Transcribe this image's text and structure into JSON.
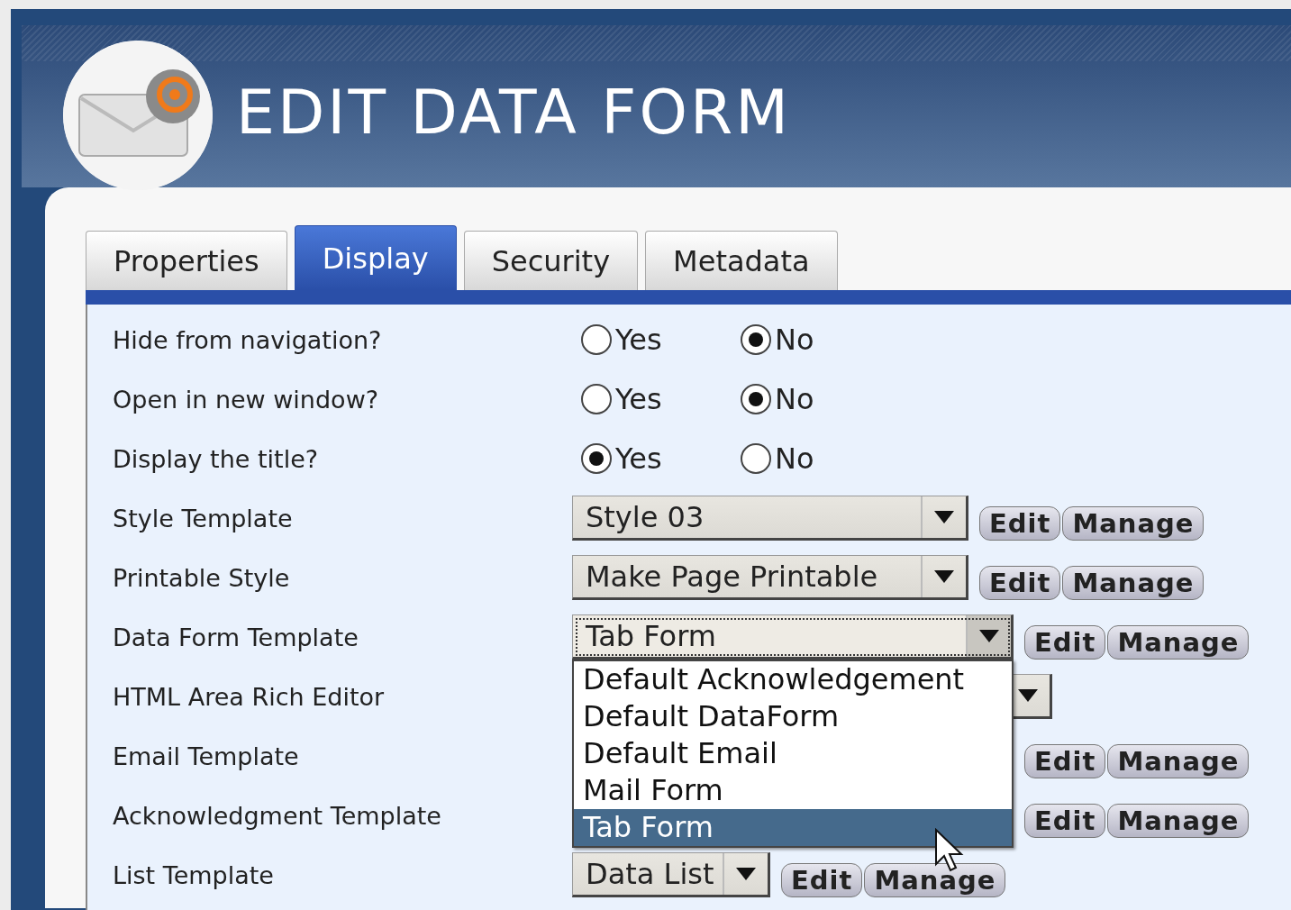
{
  "window": {
    "title": "EDIT DATA FORM"
  },
  "tabs": [
    {
      "label": "Properties",
      "selected": false
    },
    {
      "label": "Display",
      "selected": true
    },
    {
      "label": "Security",
      "selected": false
    },
    {
      "label": "Metadata",
      "selected": false
    }
  ],
  "rows": [
    {
      "kind": "radio",
      "label": "Hide from navigation?",
      "options": [
        {
          "label": "Yes",
          "selected": false
        },
        {
          "label": "No",
          "selected": true
        }
      ]
    },
    {
      "kind": "radio",
      "label": "Open in new window?",
      "options": [
        {
          "label": "Yes",
          "selected": false
        },
        {
          "label": "No",
          "selected": true
        }
      ]
    },
    {
      "kind": "radio",
      "label": "Display the title?",
      "options": [
        {
          "label": "Yes",
          "selected": true
        },
        {
          "label": "No",
          "selected": false
        }
      ]
    },
    {
      "kind": "select",
      "label": "Style Template",
      "value": "Style 03",
      "buttons": [
        "Edit",
        "Manage"
      ]
    },
    {
      "kind": "select",
      "label": "Printable Style",
      "value": "Make Page Printable",
      "buttons": [
        "Edit",
        "Manage"
      ]
    },
    {
      "kind": "select",
      "label": "Data Form Template",
      "value": "Tab Form",
      "focused": true,
      "expanded": true,
      "buttons": [
        "Edit",
        "Manage"
      ],
      "options": [
        {
          "label": "Default Acknowledgement",
          "selected": false
        },
        {
          "label": "Default DataForm",
          "selected": false
        },
        {
          "label": "Default Email",
          "selected": false
        },
        {
          "label": "Mail Form",
          "selected": false
        },
        {
          "label": "Tab Form",
          "selected": true
        }
      ]
    },
    {
      "kind": "select",
      "label": "HTML Area Rich Editor"
    },
    {
      "kind": "covered",
      "label": "Email Template",
      "buttons": [
        "Edit",
        "Manage"
      ]
    },
    {
      "kind": "covered",
      "label": "Acknowledgment Template",
      "buttons": [
        "Edit",
        "Manage"
      ]
    },
    {
      "kind": "select",
      "label": "List Template",
      "value": "Data List",
      "buttons": [
        "Edit",
        "Manage"
      ]
    }
  ]
}
